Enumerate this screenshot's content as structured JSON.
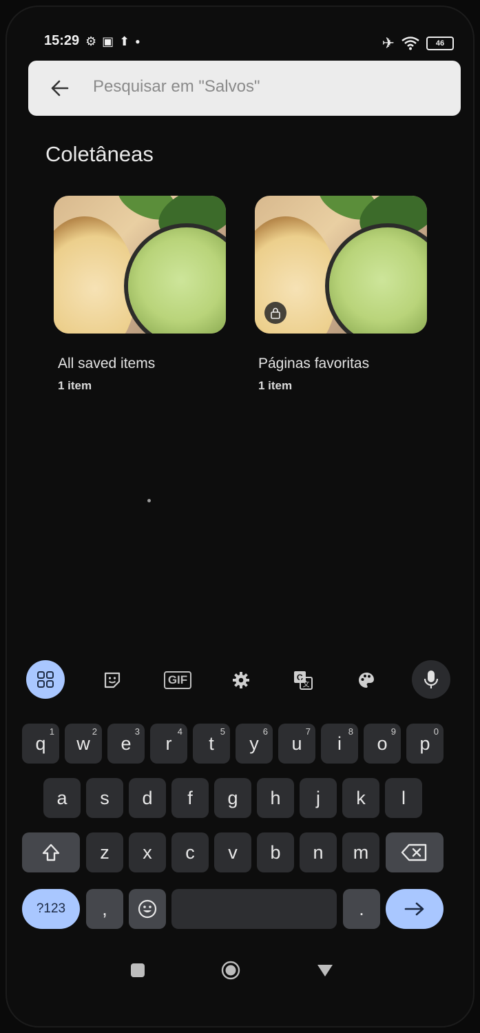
{
  "status_bar": {
    "time": "15:29",
    "battery": "46"
  },
  "search": {
    "placeholder": "Pesquisar em \"Salvos\""
  },
  "section_title": "Coletâneas",
  "collections": [
    {
      "title": "All saved items",
      "count": "1 item",
      "locked": false
    },
    {
      "title": "Páginas favoritas",
      "count": "1 item",
      "locked": true
    }
  ],
  "keyboard_toolbar": {
    "items": [
      "apps-grid-icon",
      "sticker-icon",
      "GIF",
      "gear-icon",
      "translate-icon",
      "palette-icon",
      "mic-icon"
    ],
    "gif_label": "GIF"
  },
  "keyboard": {
    "row1": [
      {
        "k": "q",
        "n": "1"
      },
      {
        "k": "w",
        "n": "2"
      },
      {
        "k": "e",
        "n": "3"
      },
      {
        "k": "r",
        "n": "4"
      },
      {
        "k": "t",
        "n": "5"
      },
      {
        "k": "y",
        "n": "6"
      },
      {
        "k": "u",
        "n": "7"
      },
      {
        "k": "i",
        "n": "8"
      },
      {
        "k": "o",
        "n": "9"
      },
      {
        "k": "p",
        "n": "0"
      }
    ],
    "row2": [
      "a",
      "s",
      "d",
      "f",
      "g",
      "h",
      "j",
      "k",
      "l"
    ],
    "row3": [
      "z",
      "x",
      "c",
      "v",
      "b",
      "n",
      "m"
    ],
    "symbols_label": "?123",
    "comma": ",",
    "period": "."
  },
  "colors": {
    "accent": "#a9c7ff",
    "key": "#2d2e31",
    "background": "#0d0d0d"
  }
}
